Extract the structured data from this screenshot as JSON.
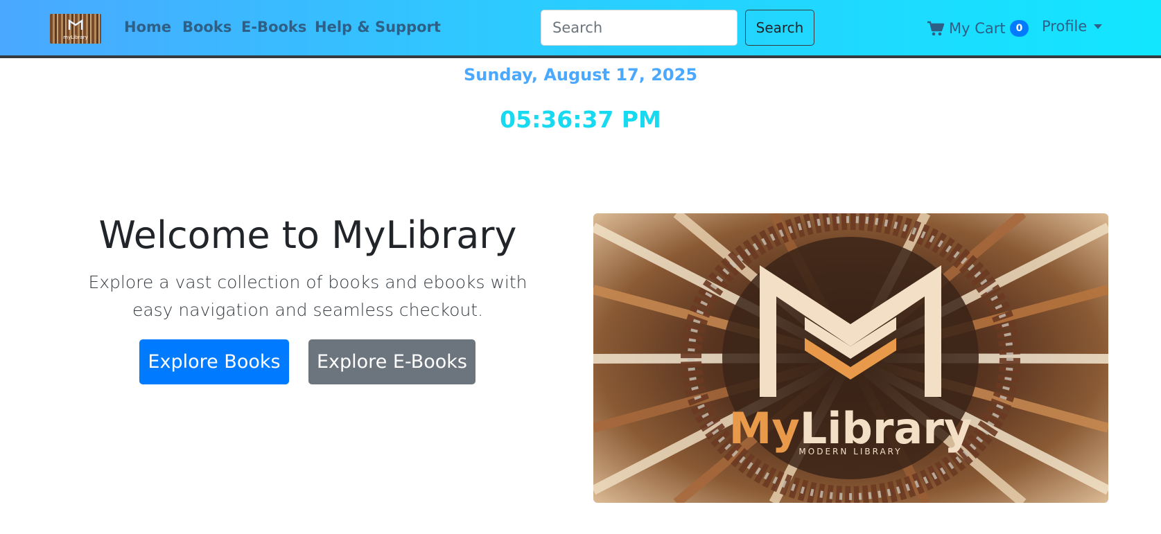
{
  "nav": {
    "brand_logo_text": "myLibrary",
    "links": [
      "Home",
      "Books",
      "E-Books",
      "Help & Support"
    ],
    "search": {
      "placeholder": "Search",
      "value": "",
      "button_label": "Search"
    },
    "cart": {
      "label": "My Cart",
      "count": "0"
    },
    "profile_label": "Profile",
    "icons": {
      "cart": "shopping-cart-icon",
      "profile_caret": "chevron-down-icon"
    }
  },
  "datetime": {
    "date": "Sunday, August 17, 2025",
    "time": "05:36:37 PM"
  },
  "hero": {
    "title": "Welcome to MyLibrary",
    "subtitle": "Explore a vast collection of books and ebooks with easy navigation and seamless checkout.",
    "primary_button": "Explore Books",
    "secondary_button": "Explore E-Books",
    "image_brand_text": "MyLibrary",
    "image_tagline": "MODERN LIBRARY"
  },
  "colors": {
    "nav_gradient_start": "#4aa8ff",
    "nav_gradient_end": "#12e6ff",
    "date_color": "#4aa8ff",
    "time_color": "#17d9f0",
    "primary": "#007bff",
    "secondary": "#6c757d",
    "brand_orange": "#e89a4a"
  }
}
